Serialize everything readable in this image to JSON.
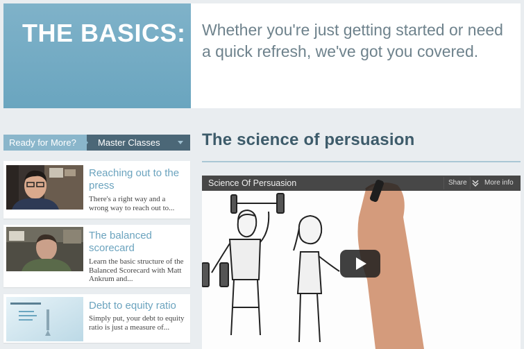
{
  "hero": {
    "title": "THE BASICS:",
    "text": "Whether you're just getting started or need a quick refresh, we've got you covered."
  },
  "tabs": {
    "ready": "Ready for More?",
    "master": "Master Classes"
  },
  "cards": [
    {
      "title": "Reaching out to the press",
      "description": "There's a right way and a wrong way to reach out to..."
    },
    {
      "title": "The balanced scorecard",
      "description": "Learn the basic structure of the Balanced Scorecard with Matt Ankrum and..."
    },
    {
      "title": "Debt to equity ratio",
      "description": "Simply put, your debt to equity ratio is just a measure of..."
    }
  ],
  "main": {
    "title": "The science of persuasion"
  },
  "video": {
    "title": "Science Of Persuasion",
    "share_label": "Share",
    "more_info_label": "More info",
    "play_icon": "play-icon"
  },
  "colors": {
    "hero_blue": "#6aa5bf",
    "tab_dark": "#4b6777",
    "link_blue": "#6ba3be",
    "heading": "#3d5b6a"
  }
}
